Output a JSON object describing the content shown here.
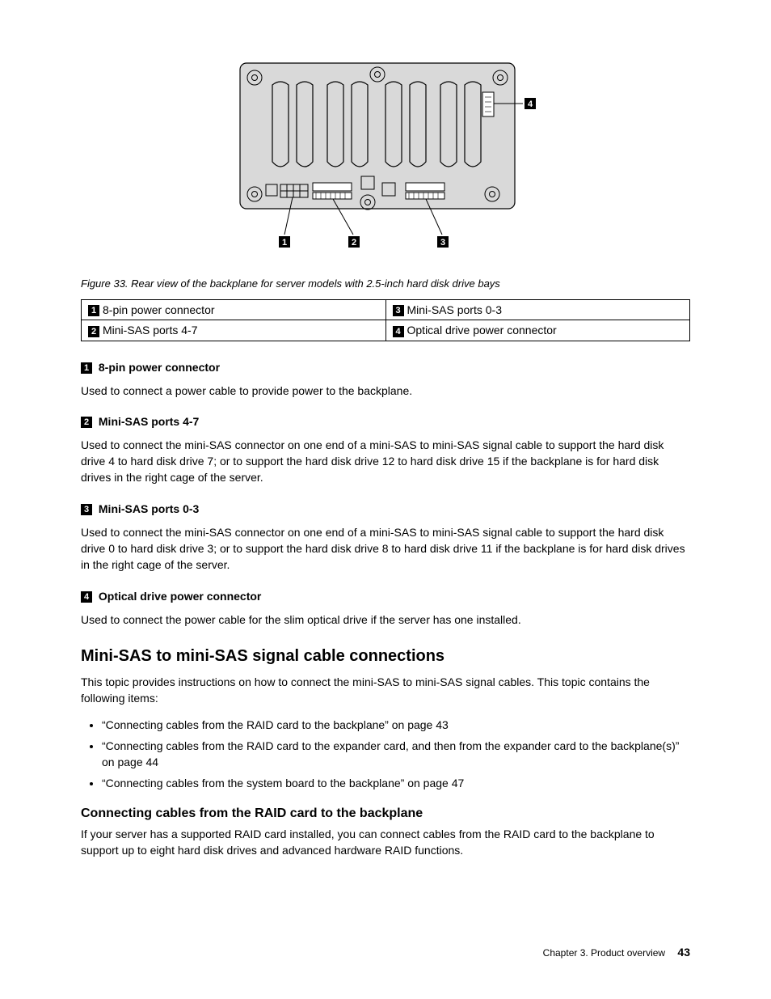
{
  "figure": {
    "caption": "Figure 33.  Rear view of the backplane for server models with 2.5-inch hard disk drive bays",
    "callouts": [
      "1",
      "2",
      "3",
      "4"
    ]
  },
  "table": {
    "rows": [
      {
        "left_num": "1",
        "left_text": "8-pin power connector",
        "right_num": "3",
        "right_text": "Mini-SAS ports 0-3"
      },
      {
        "left_num": "2",
        "left_text": "Mini-SAS ports 4-7",
        "right_num": "4",
        "right_text": "Optical drive power connector"
      }
    ]
  },
  "sections": [
    {
      "num": "1",
      "title": "8-pin power connector",
      "body": "Used to connect a power cable to provide power to the backplane."
    },
    {
      "num": "2",
      "title": "Mini-SAS ports 4-7",
      "body": "Used to connect the mini-SAS connector on one end of a mini-SAS to mini-SAS signal cable to support the hard disk drive 4 to hard disk drive 7; or to support the hard disk drive 12 to hard disk drive 15 if the backplane is for hard disk drives in the right cage of the server."
    },
    {
      "num": "3",
      "title": "Mini-SAS ports 0-3",
      "body": "Used to connect the mini-SAS connector on one end of a mini-SAS to mini-SAS signal cable to support the hard disk drive 0 to hard disk drive 3; or to support the hard disk drive 8 to hard disk drive 11 if the backplane is for hard disk drives in the right cage of the server."
    },
    {
      "num": "4",
      "title": "Optical drive power connector",
      "body": "Used to connect the power cable for the slim optical drive if the server has one installed."
    }
  ],
  "main_heading": "Mini-SAS to mini-SAS signal cable connections",
  "main_intro": "This topic provides instructions on how to connect the mini-SAS to mini-SAS signal cables.  This topic contains the following items:",
  "bullets": [
    "“Connecting cables from the RAID card to the backplane” on page 43",
    "“Connecting cables from the RAID card to the expander card, and then from the expander card to the backplane(s)” on page 44",
    "“Connecting cables from the system board to the backplane” on page 47"
  ],
  "sub_heading": "Connecting cables from the RAID card to the backplane",
  "sub_body": "If your server has a supported RAID card installed, you can connect cables from the RAID card to the backplane to support up to eight hard disk drives and advanced hardware RAID functions.",
  "footer": {
    "chapter": "Chapter 3.  Product overview",
    "page": "43"
  }
}
